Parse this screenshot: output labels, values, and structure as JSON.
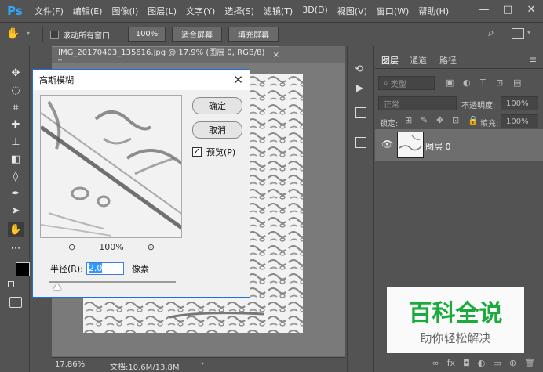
{
  "app": {
    "logo": "Ps"
  },
  "menu": [
    "文件(F)",
    "编辑(E)",
    "图像(I)",
    "图层(L)",
    "文字(Y)",
    "选择(S)",
    "滤镜(T)",
    "3D(D)",
    "视图(V)",
    "窗口(W)",
    "帮助(H)"
  ],
  "window_controls": {
    "minimize": "—",
    "maximize": "□",
    "close": "✕"
  },
  "options": {
    "scroll_all_label": "滚动所有窗口",
    "zoom_value": "100%",
    "fit_screen": "适合屏幕",
    "fill_screen": "填充屏幕"
  },
  "document": {
    "tab_title": "IMG_20170403_135616.jpg @ 17.9% (图层 0, RGB/8) *",
    "tab_close": "×",
    "status_zoom": "17.86%",
    "status_info": "文档:10.6M/13.8M",
    "status_arrow": "›"
  },
  "layers_panel": {
    "tabs": [
      "图层",
      "通道",
      "路径"
    ],
    "kind_label": "类型",
    "blend_mode": "正常",
    "opacity_label": "不透明度:",
    "opacity_value": "100%",
    "lock_label": "锁定:",
    "fill_label": "填充:",
    "fill_value": "100%",
    "layer_name": "图层 0",
    "footer_icons": [
      "link-icon",
      "fx-icon",
      "mask-icon",
      "adjustment-icon",
      "folder-icon",
      "new-layer-icon",
      "trash-icon"
    ]
  },
  "dialog": {
    "title": "高斯模糊",
    "ok_label": "确定",
    "cancel_label": "取消",
    "preview_label": "预览(P)",
    "preview_checked": true,
    "zoom_out": "⊖",
    "zoom_level": "100%",
    "zoom_in": "⊕",
    "radius_label": "半径(R):",
    "radius_value": "2.0",
    "radius_unit": "像素",
    "slider_position": 0.07
  },
  "watermark": {
    "title": "百科全说",
    "subtitle": "助你轻松解决"
  },
  "colors": {
    "ps_blue": "#31a8ff",
    "panel_bg": "#535353",
    "canvas_bg": "#6a6a6a",
    "dialog_border": "#1e6fd9",
    "watermark_green": "#1aab3c"
  }
}
